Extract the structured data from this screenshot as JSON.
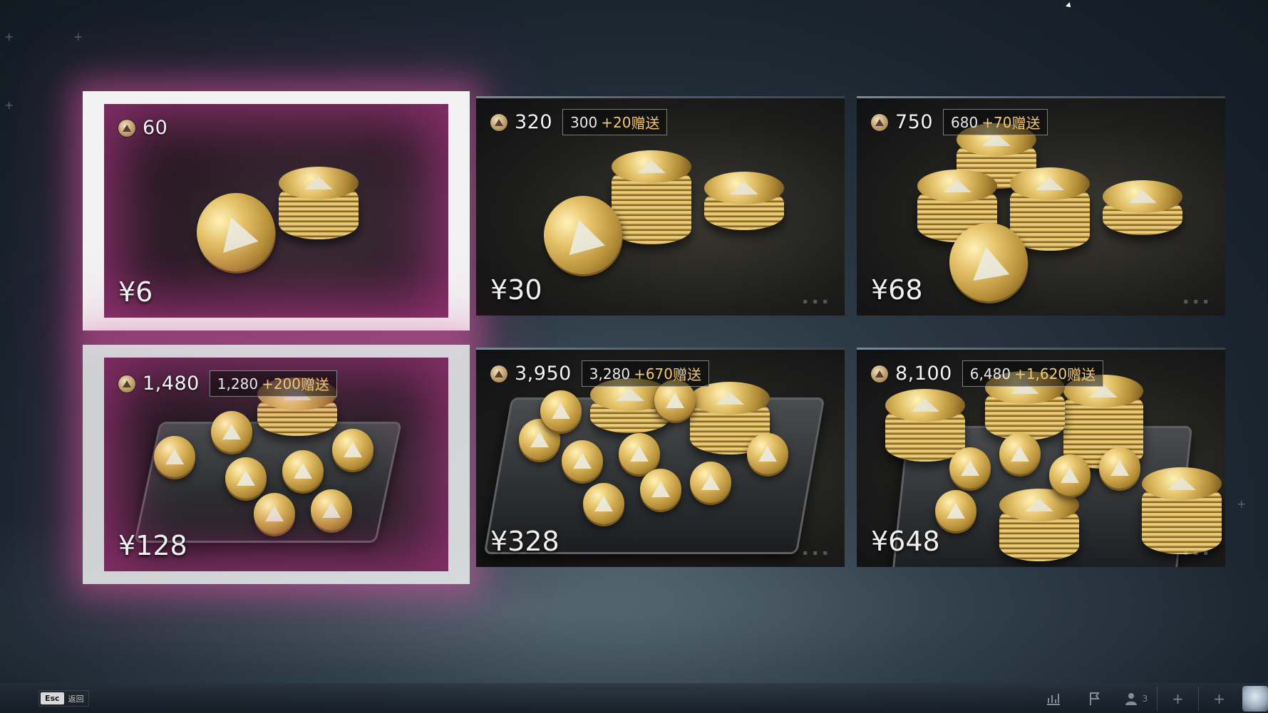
{
  "footer": {
    "esc_key": "Esc",
    "back_label": "返回",
    "friends_count": "3",
    "icons": [
      "stats-icon",
      "flag-icon",
      "friends-icon",
      "plus-icon",
      "plus-icon",
      "avatar"
    ]
  },
  "packages": [
    {
      "amount": "60",
      "base": "",
      "bonus": "",
      "gift_label": "",
      "price": "¥6",
      "state": "selected"
    },
    {
      "amount": "320",
      "base": "300",
      "bonus": "+20",
      "gift_label": "赠送",
      "price": "¥30",
      "state": "normal"
    },
    {
      "amount": "750",
      "base": "680",
      "bonus": "+70",
      "gift_label": "赠送",
      "price": "¥68",
      "state": "normal"
    },
    {
      "amount": "1,480",
      "base": "1,280",
      "bonus": "+200",
      "gift_label": "赠送",
      "price": "¥128",
      "state": "hovered"
    },
    {
      "amount": "3,950",
      "base": "3,280",
      "bonus": "+670",
      "gift_label": "赠送",
      "price": "¥328",
      "state": "normal"
    },
    {
      "amount": "8,100",
      "base": "6,480",
      "bonus": "+1,620",
      "gift_label": "赠送",
      "price": "¥648",
      "state": "normal"
    }
  ],
  "colors": {
    "selection_glow": "#e65aaa",
    "bonus_gold": "#f2c77a"
  }
}
